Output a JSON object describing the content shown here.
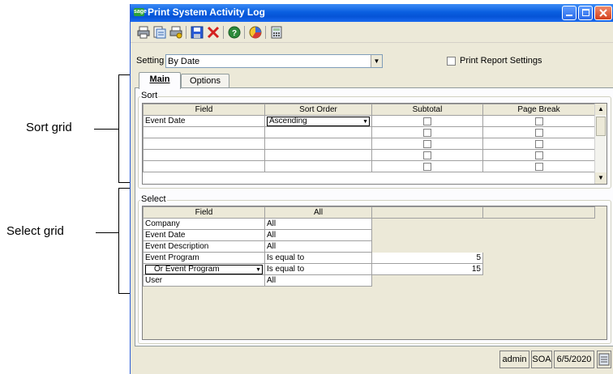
{
  "callouts": {
    "sort_grid": "Sort grid",
    "select_grid": "Select grid"
  },
  "window": {
    "title": "Print System Activity Log",
    "logo_text": "sage"
  },
  "toolbar": {
    "icons": [
      "print-icon",
      "print-preview-icon",
      "printer-setup-icon",
      "save-icon",
      "delete-icon",
      "help-icon",
      "chart-icon",
      "calculator-icon"
    ]
  },
  "setting": {
    "label": "Setting",
    "value": "By Date",
    "print_report_settings_label": "Print Report Settings",
    "print_report_settings_checked": false
  },
  "tabs": [
    {
      "label": "Main",
      "active": true
    },
    {
      "label": "Options",
      "active": false
    }
  ],
  "sort": {
    "group_label": "Sort",
    "columns": [
      "Field",
      "Sort Order",
      "Subtotal",
      "Page Break"
    ],
    "rows": [
      {
        "field": "Event Date",
        "sort_order": "Ascending",
        "subtotal": false,
        "page_break": false
      },
      {
        "field": "",
        "sort_order": "",
        "subtotal": false,
        "page_break": false
      },
      {
        "field": "",
        "sort_order": "",
        "subtotal": false,
        "page_break": false
      },
      {
        "field": "",
        "sort_order": "",
        "subtotal": false,
        "page_break": false
      },
      {
        "field": "",
        "sort_order": "",
        "subtotal": false,
        "page_break": false
      }
    ]
  },
  "select": {
    "group_label": "Select",
    "columns": [
      "Field",
      "All",
      "",
      ""
    ],
    "rows": [
      {
        "field": "Company",
        "op": "All",
        "value": ""
      },
      {
        "field": "Event Date",
        "op": "All",
        "value": ""
      },
      {
        "field": "Event Description",
        "op": "All",
        "value": ""
      },
      {
        "field": "Event Program",
        "op": "Is equal to",
        "value": "5"
      },
      {
        "field": "Or Event Program",
        "op": "Is equal to",
        "value": "15"
      },
      {
        "field": "User",
        "op": "All",
        "value": ""
      }
    ]
  },
  "status": {
    "user": "admin",
    "company": "SOA",
    "date": "6/5/2020"
  }
}
